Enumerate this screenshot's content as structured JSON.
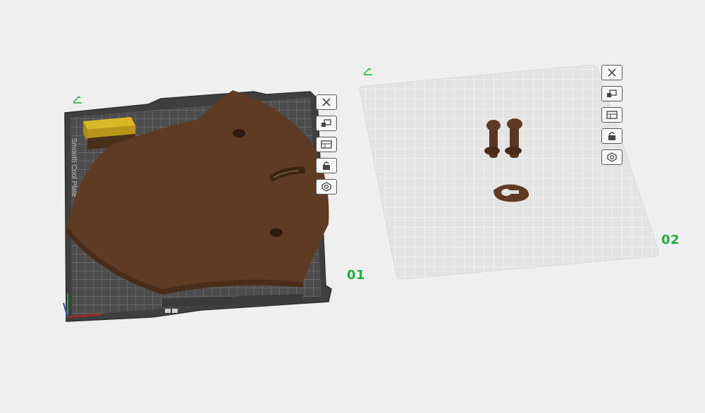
{
  "colors": {
    "background": "#efefef",
    "plate_dark": "#4a4a4a",
    "plate_light": "#e2e2e2",
    "part_brown": "#5e3a22",
    "accent_green": "#1fae3a",
    "filament_yellow": "#c9a41a"
  },
  "plates": [
    {
      "number": "01",
      "tools": [
        "close-icon",
        "arrange-icon",
        "layout-icon",
        "lock-icon",
        "settings-icon"
      ]
    },
    {
      "number": "02",
      "tools": [
        "close-icon",
        "arrange-icon",
        "layout-icon",
        "lock-icon",
        "settings-icon"
      ]
    }
  ],
  "plate1_label": "Smooth Cool Plate"
}
